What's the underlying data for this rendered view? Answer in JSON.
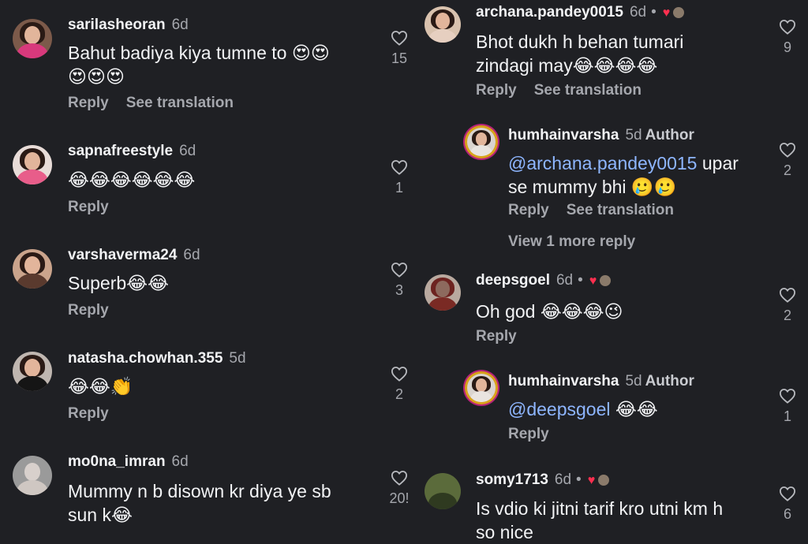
{
  "left": [
    {
      "user": "sarilasheoran",
      "age": "6d",
      "text1": "Bahut badiya kiya tumne to 😍😍",
      "text2": "😍😍😍",
      "actions": [
        "Reply",
        "See translation"
      ],
      "likes": "15"
    },
    {
      "user": "sapnafreestyle",
      "age": "6d",
      "text1": "😂😂😂😂😂😂",
      "actions": [
        "Reply"
      ],
      "likes": "1"
    },
    {
      "user": "varshaverma24",
      "age": "6d",
      "text1": "Superb😂😂",
      "actions": [
        "Reply"
      ],
      "likes": "3"
    },
    {
      "user": "natasha.chowhan.355",
      "age": "5d",
      "text1": "😂😂👏",
      "actions": [
        "Reply"
      ],
      "likes": "2"
    },
    {
      "user": "mo0na_imran",
      "age": "6d",
      "text1": "Mummy n b disown kr diya ye sb",
      "text2": "sun k😂",
      "actions": [
        "Reply"
      ],
      "likes": "20!"
    }
  ],
  "right": [
    {
      "user": "archana.pandey0015",
      "age": "6d",
      "dot": "•",
      "text1": "Bhot dukh h behan tumari",
      "text2": "zindagi may😂😂😂😂",
      "actions": [
        "Reply",
        "See translation"
      ],
      "likes": "9"
    },
    {
      "user": "humhainvarsha",
      "age": "5d",
      "author": "Author",
      "mention": "@archana.pandey0015",
      "text1rest": " upar",
      "text2": "se mummy bhi 🥲🥲",
      "actions": [
        "Reply",
        "See translation"
      ],
      "likes": "2"
    },
    {
      "user": "deepsgoel",
      "age": "6d",
      "dot": "•",
      "text1": "Oh god 😂😂😂😉",
      "actions": [
        "Reply"
      ],
      "likes": "2"
    },
    {
      "user": "humhainvarsha",
      "age": "5d",
      "author": "Author",
      "mention": "@deepsgoel",
      "text1rest": " 😂😂",
      "actions": [
        "Reply"
      ],
      "likes": "1"
    },
    {
      "user": "somy1713",
      "age": "6d",
      "dot": "•",
      "text1": "Is vdio ki jitni tarif kro utni km h",
      "text2": "so nice",
      "likes": "6"
    }
  ],
  "view_more": "View 1 more reply",
  "icons": {
    "like": "heart-outline-icon",
    "creator_liked": "red-heart-icon"
  },
  "colors": {
    "background": "#1f2024",
    "muted": "#a5a7ad",
    "mention": "#8eb6ff",
    "heart": "#ff2f4f"
  }
}
